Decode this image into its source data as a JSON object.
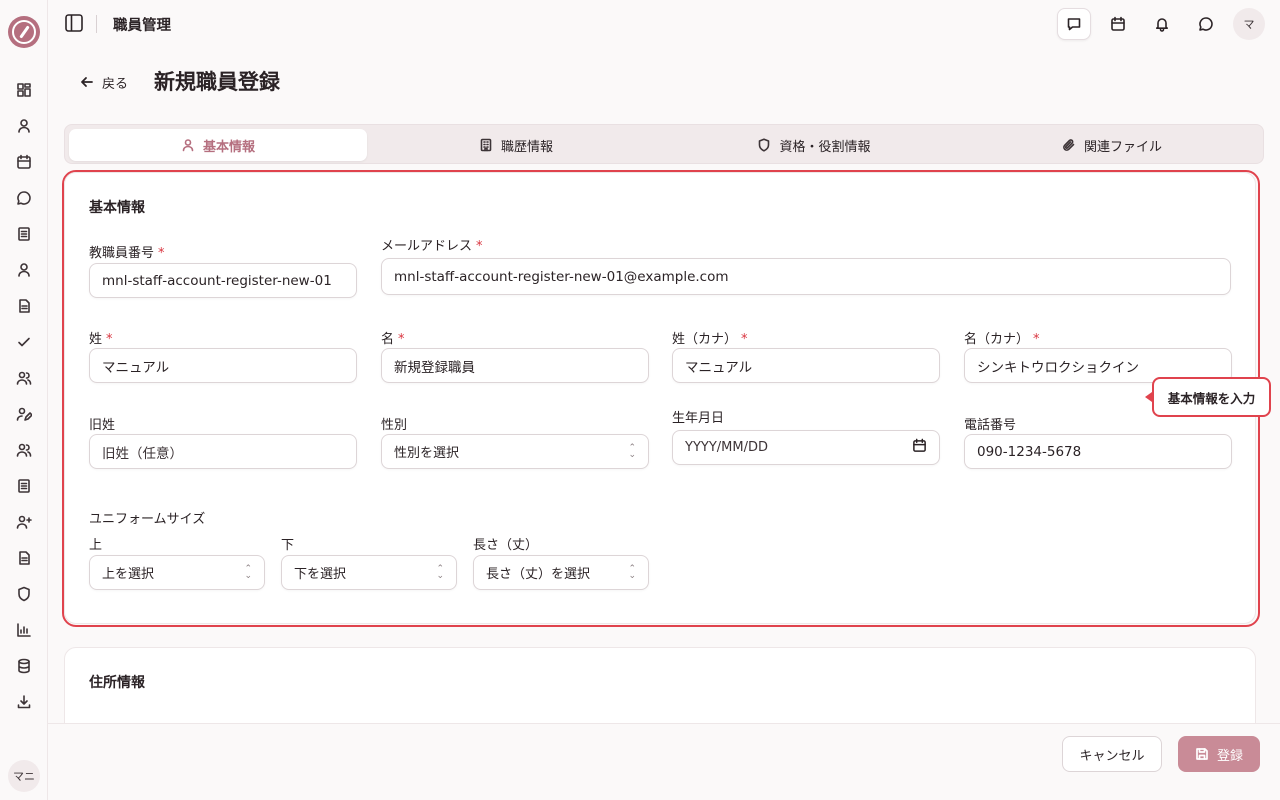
{
  "app": {
    "title": "職員管理",
    "user_initials": "マ",
    "sidebar_user": "マニ"
  },
  "header": {
    "back_label": "戻る",
    "page_title": "新規職員登録"
  },
  "tabs": [
    {
      "label": "基本情報",
      "icon": "user-icon",
      "active": true
    },
    {
      "label": "職歴情報",
      "icon": "building-icon",
      "active": false
    },
    {
      "label": "資格・役割情報",
      "icon": "shield-icon",
      "active": false
    },
    {
      "label": "関連ファイル",
      "icon": "paperclip-icon",
      "active": false
    }
  ],
  "basic": {
    "section_title": "基本情報",
    "staff_number": {
      "label": "教職員番号",
      "value": "mnl-staff-account-register-new-01"
    },
    "email": {
      "label": "メールアドレス",
      "value": "mnl-staff-account-register-new-01@example.com"
    },
    "last_name": {
      "label": "姓",
      "value": "マニュアル"
    },
    "first_name": {
      "label": "名",
      "value": "新規登録職員"
    },
    "last_name_kana": {
      "label": "姓（カナ）",
      "value": "マニュアル"
    },
    "first_name_kana": {
      "label": "名（カナ）",
      "value": "シンキトウロクショクイン"
    },
    "former_name": {
      "label": "旧姓",
      "placeholder": "旧姓（任意）"
    },
    "gender": {
      "label": "性別",
      "placeholder": "性別を選択"
    },
    "birthdate": {
      "label": "生年月日",
      "placeholder": "YYYY/MM/DD"
    },
    "phone": {
      "label": "電話番号",
      "value": "090-1234-5678"
    },
    "uniform": {
      "title": "ユニフォームサイズ",
      "top": {
        "label": "上",
        "placeholder": "上を選択"
      },
      "bottom": {
        "label": "下",
        "placeholder": "下を選択"
      },
      "length": {
        "label": "長さ（丈）",
        "placeholder": "長さ（丈）を選択"
      }
    },
    "required_mark": "*"
  },
  "tooltip": "基本情報を入力",
  "address": {
    "section_title": "住所情報"
  },
  "footer": {
    "cancel_label": "キャンセル",
    "submit_label": "登録"
  },
  "colors": {
    "accent": "#b56f7f",
    "highlight": "#e0434d",
    "submit_bg": "#c98b97"
  }
}
